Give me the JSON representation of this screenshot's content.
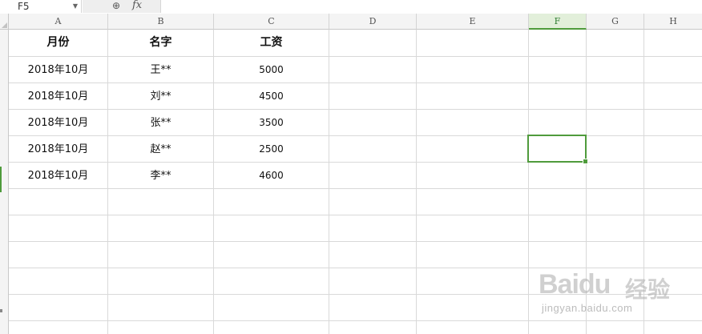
{
  "formula_bar": {
    "name_box": "F5",
    "fx_label": "fx",
    "formula_value": ""
  },
  "columns": [
    "A",
    "B",
    "C",
    "D",
    "E",
    "F",
    "G",
    "H"
  ],
  "active_column": "F",
  "selected_cell": "F5",
  "headers": {
    "month": "月份",
    "name": "名字",
    "salary": "工资"
  },
  "rows": [
    {
      "month": "2018年10月",
      "name": "王**",
      "salary": "5000"
    },
    {
      "month": "2018年10月",
      "name": "刘**",
      "salary": "4500"
    },
    {
      "month": "2018年10月",
      "name": "张**",
      "salary": "3500"
    },
    {
      "month": "2018年10月",
      "name": "赵**",
      "salary": "2500"
    },
    {
      "month": "2018年10月",
      "name": "李**",
      "salary": "4600"
    }
  ],
  "watermark": {
    "logo": "Baidu",
    "brand_cn": "经验",
    "url": "jingyan.baidu.com"
  },
  "colors": {
    "accent": "#4f9b3c",
    "grid": "#d9d9d9",
    "header_bg": "#f4f4f4"
  }
}
